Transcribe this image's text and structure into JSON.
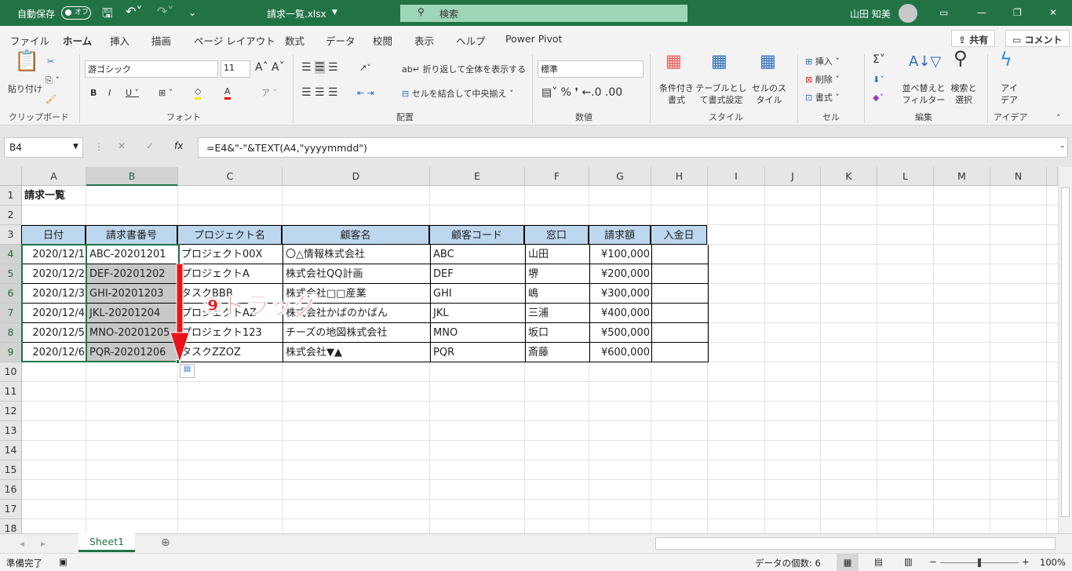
{
  "titlebar": {
    "autosave_label": "自動保存",
    "autosave_state": "オフ",
    "filename": "請求一覧.xlsx",
    "search_placeholder": "検索",
    "user": "山田 知美"
  },
  "tabs": [
    "ファイル",
    "ホーム",
    "挿入",
    "描画",
    "ページ レイアウト",
    "数式",
    "データ",
    "校閲",
    "表示",
    "ヘルプ",
    "Power Pivot"
  ],
  "share_label": "共有",
  "comment_label": "コメント",
  "ribbon": {
    "clipboard": {
      "paste": "貼り付け",
      "group": "クリップボード"
    },
    "font": {
      "name": "游ゴシック",
      "size": "11",
      "group": "フォント"
    },
    "alignment": {
      "wrap": "折り返して全体を表示する",
      "merge": "セルを結合して中央揃え",
      "group": "配置"
    },
    "number": {
      "format": "標準",
      "group": "数値"
    },
    "styles": {
      "conditional": "条件付き書式",
      "table": "テーブルとして書式設定",
      "cell": "セルのスタイル",
      "group": "スタイル"
    },
    "cells": {
      "insert": "挿入",
      "delete": "削除",
      "format": "書式",
      "group": "セル"
    },
    "editing": {
      "sort": "並べ替えとフィルター",
      "find": "検索と選択",
      "group": "編集"
    },
    "ideas": {
      "label": "アイデア",
      "group": "アイデア"
    }
  },
  "formula_bar": {
    "name_box": "B4",
    "formula": "=E4&\"-\"&TEXT(A4,\"yyyymmdd\")"
  },
  "columns": [
    "A",
    "B",
    "C",
    "D",
    "E",
    "F",
    "G",
    "H",
    "I",
    "J",
    "K",
    "L",
    "M",
    "N"
  ],
  "rows": [
    "1",
    "2",
    "3",
    "4",
    "5",
    "6",
    "7",
    "8",
    "9",
    "10",
    "11",
    "12",
    "13",
    "14",
    "15",
    "16",
    "17",
    "18"
  ],
  "title_cell": "請求一覧",
  "table": {
    "headers": [
      "日付",
      "請求書番号",
      "プロジェクト名",
      "顧客名",
      "顧客コード",
      "窓口",
      "請求額",
      "入金日"
    ],
    "rows": [
      [
        "2020/12/1",
        "ABC-20201201",
        "プロジェクト00X",
        "〇△情報株式会社",
        "ABC",
        "山田",
        "¥100,000",
        ""
      ],
      [
        "2020/12/2",
        "DEF-20201202",
        "プロジェクトA",
        "株式会社QQ計画",
        "DEF",
        "堺",
        "¥200,000",
        ""
      ],
      [
        "2020/12/3",
        "GHI-20201203",
        "タスクBBB",
        "株式会社□□産業",
        "GHI",
        "嶋",
        "¥300,000",
        ""
      ],
      [
        "2020/12/4",
        "JKL-20201204",
        "プロジェクトAZ",
        "株式会社かばのかばん",
        "JKL",
        "三浦",
        "¥400,000",
        ""
      ],
      [
        "2020/12/5",
        "MNO-20201205",
        "プロジェクト123",
        "チーズの地図株式会社",
        "MNO",
        "坂口",
        "¥500,000",
        ""
      ],
      [
        "2020/12/6",
        "PQR-20201206",
        "タスクZZOZ",
        "株式会社▼▲",
        "PQR",
        "斎藤",
        "¥600,000",
        ""
      ]
    ]
  },
  "annotation": "⑨ドラッグ",
  "sheet_tab": "Sheet1",
  "status": {
    "ready": "準備完了",
    "count": "データの個数: 6",
    "zoom": "100%"
  },
  "colors": {
    "green": "#217346",
    "header_fill": "#bdd7ee",
    "selection": "#c8c8c8",
    "arrow": "#e8141b"
  }
}
